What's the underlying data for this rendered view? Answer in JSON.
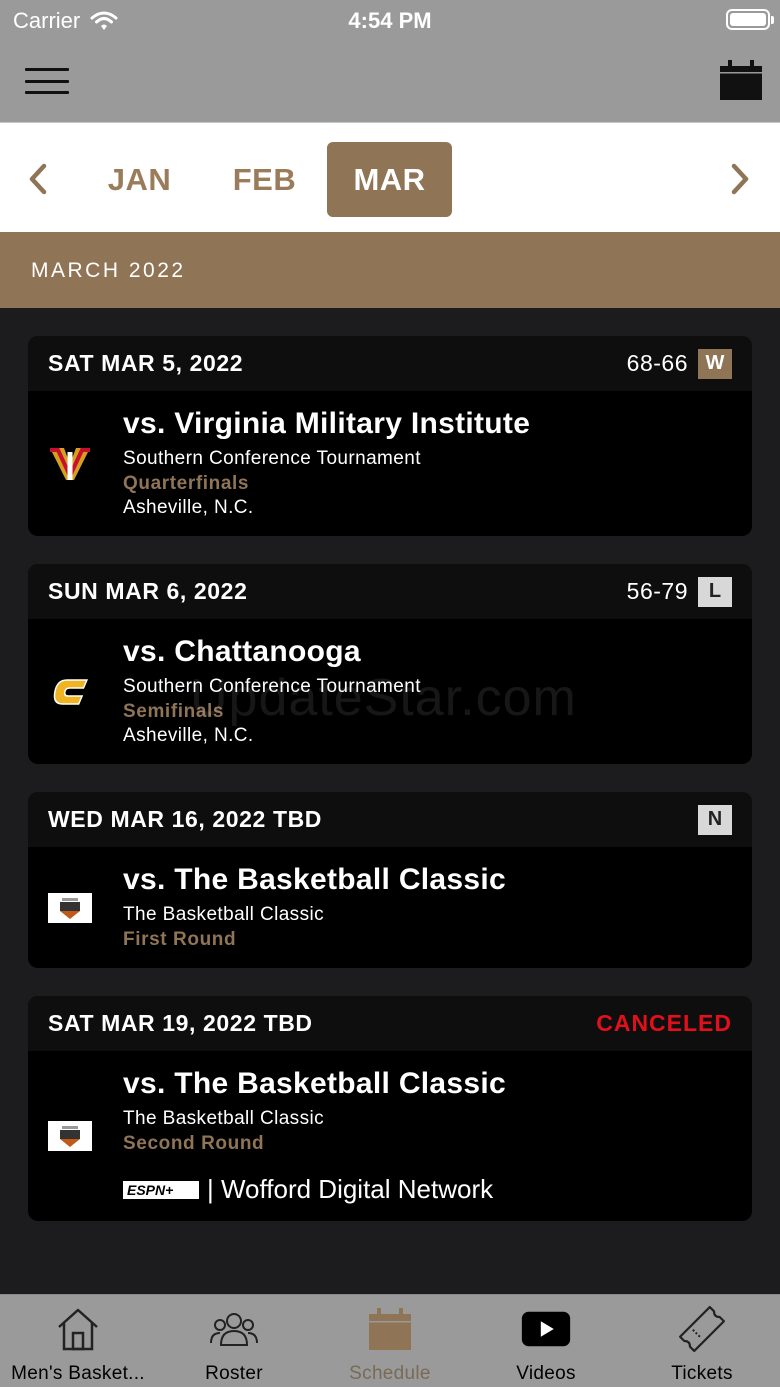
{
  "status_bar": {
    "carrier": "Carrier",
    "time": "4:54 PM"
  },
  "months": {
    "items": [
      {
        "label": "JAN",
        "active": false
      },
      {
        "label": "FEB",
        "active": false
      },
      {
        "label": "MAR",
        "active": true
      }
    ]
  },
  "month_header": "MARCH 2022",
  "games": [
    {
      "date": "SAT MAR 5, 2022",
      "score": "68-66",
      "result": "W",
      "opponent": "vs. Virginia Military Institute",
      "event": "Southern Conference Tournament",
      "round": "Quarterfinals",
      "location": "Asheville, N.C.",
      "logo": "vmi-logo"
    },
    {
      "date": "SUN MAR 6, 2022",
      "score": "56-79",
      "result": "L",
      "opponent": "vs. Chattanooga",
      "event": "Southern Conference Tournament",
      "round": "Semifinals",
      "location": "Asheville, N.C.",
      "logo": "chattanooga-logo"
    },
    {
      "date": "WED MAR 16, 2022 TBD",
      "result": "N",
      "opponent": "vs. The Basketball Classic",
      "event": "The Basketball Classic",
      "round": "First Round",
      "logo": "basketball-classic-logo"
    },
    {
      "date": "SAT MAR 19, 2022 TBD",
      "status": "CANCELED",
      "opponent": "vs. The Basketball Classic",
      "event": "The Basketball Classic",
      "round": "Second Round",
      "logo": "basketball-classic-logo",
      "broadcast": "| Wofford Digital Network",
      "broadcast_logo_text": "ESPN+"
    }
  ],
  "watermark": "UpdateStar.com",
  "tabs": [
    {
      "label": "Men's Basket...",
      "icon": "home-icon",
      "active": false
    },
    {
      "label": "Roster",
      "icon": "roster-icon",
      "active": false
    },
    {
      "label": "Schedule",
      "icon": "calendar-icon",
      "active": true
    },
    {
      "label": "Videos",
      "icon": "play-icon",
      "active": false
    },
    {
      "label": "Tickets",
      "icon": "ticket-icon",
      "active": false
    }
  ],
  "colors": {
    "accent": "#8f7456",
    "bar": "#9a9a9a",
    "canceled": "#e3101a"
  }
}
